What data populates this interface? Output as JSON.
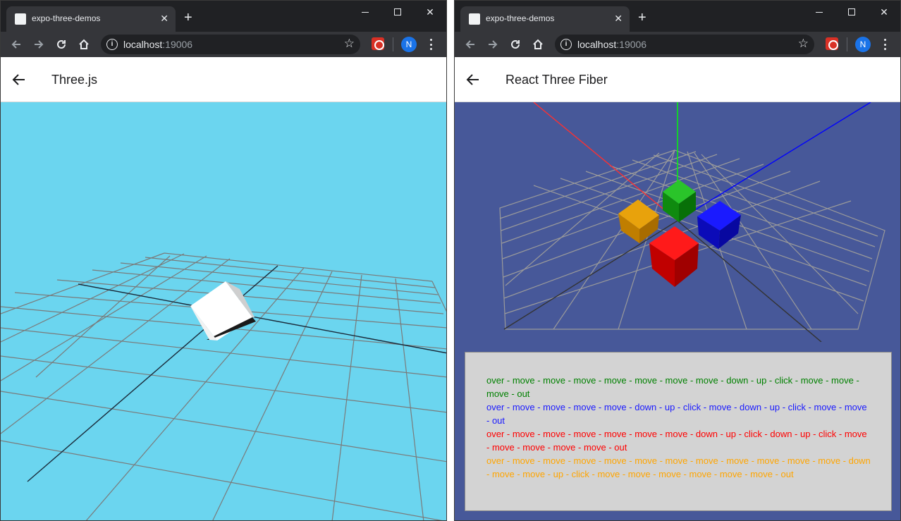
{
  "colors": {
    "three_background": "#6bd5ef",
    "fiber_background": "#475899",
    "event_panel_background": "#d3d3d3",
    "green": "#008000",
    "blue": "#1a1aff",
    "red": "#ff0000",
    "orange": "#ffa500"
  },
  "browser_left": {
    "tab_title": "expo-three-demos",
    "url_host": "localhost",
    "url_port": ":19006",
    "profile_initial": "N"
  },
  "browser_right": {
    "tab_title": "expo-three-demos",
    "url_host": "localhost",
    "url_port": ":19006",
    "profile_initial": "N"
  },
  "left_app": {
    "title": "Three.js",
    "scene_icons": [
      "white-cube",
      "floor-grid"
    ]
  },
  "right_app": {
    "title": "React Three Fiber",
    "scene_icons": [
      "green-cube",
      "blue-cube",
      "red-cube",
      "orange-cube",
      "floor-grid",
      "axes-helper"
    ],
    "event_log": [
      {
        "color": "green",
        "text": "over - move - move - move - move - move - move - move - down - up - click - move - move - move - out"
      },
      {
        "color": "blue",
        "text": "over - move - move - move - move - down - up - click - move - down - up - click - move - move - out"
      },
      {
        "color": "red",
        "text": "over - move - move - move - move - move - move - down - up - click - down - up - click - move - move - move - move - move - out"
      },
      {
        "color": "orange",
        "text": "over - move - move - move - move - move - move - move - move - move - move - move - down - move - move - up - click - move - move - move - move - move - move - out"
      }
    ]
  }
}
